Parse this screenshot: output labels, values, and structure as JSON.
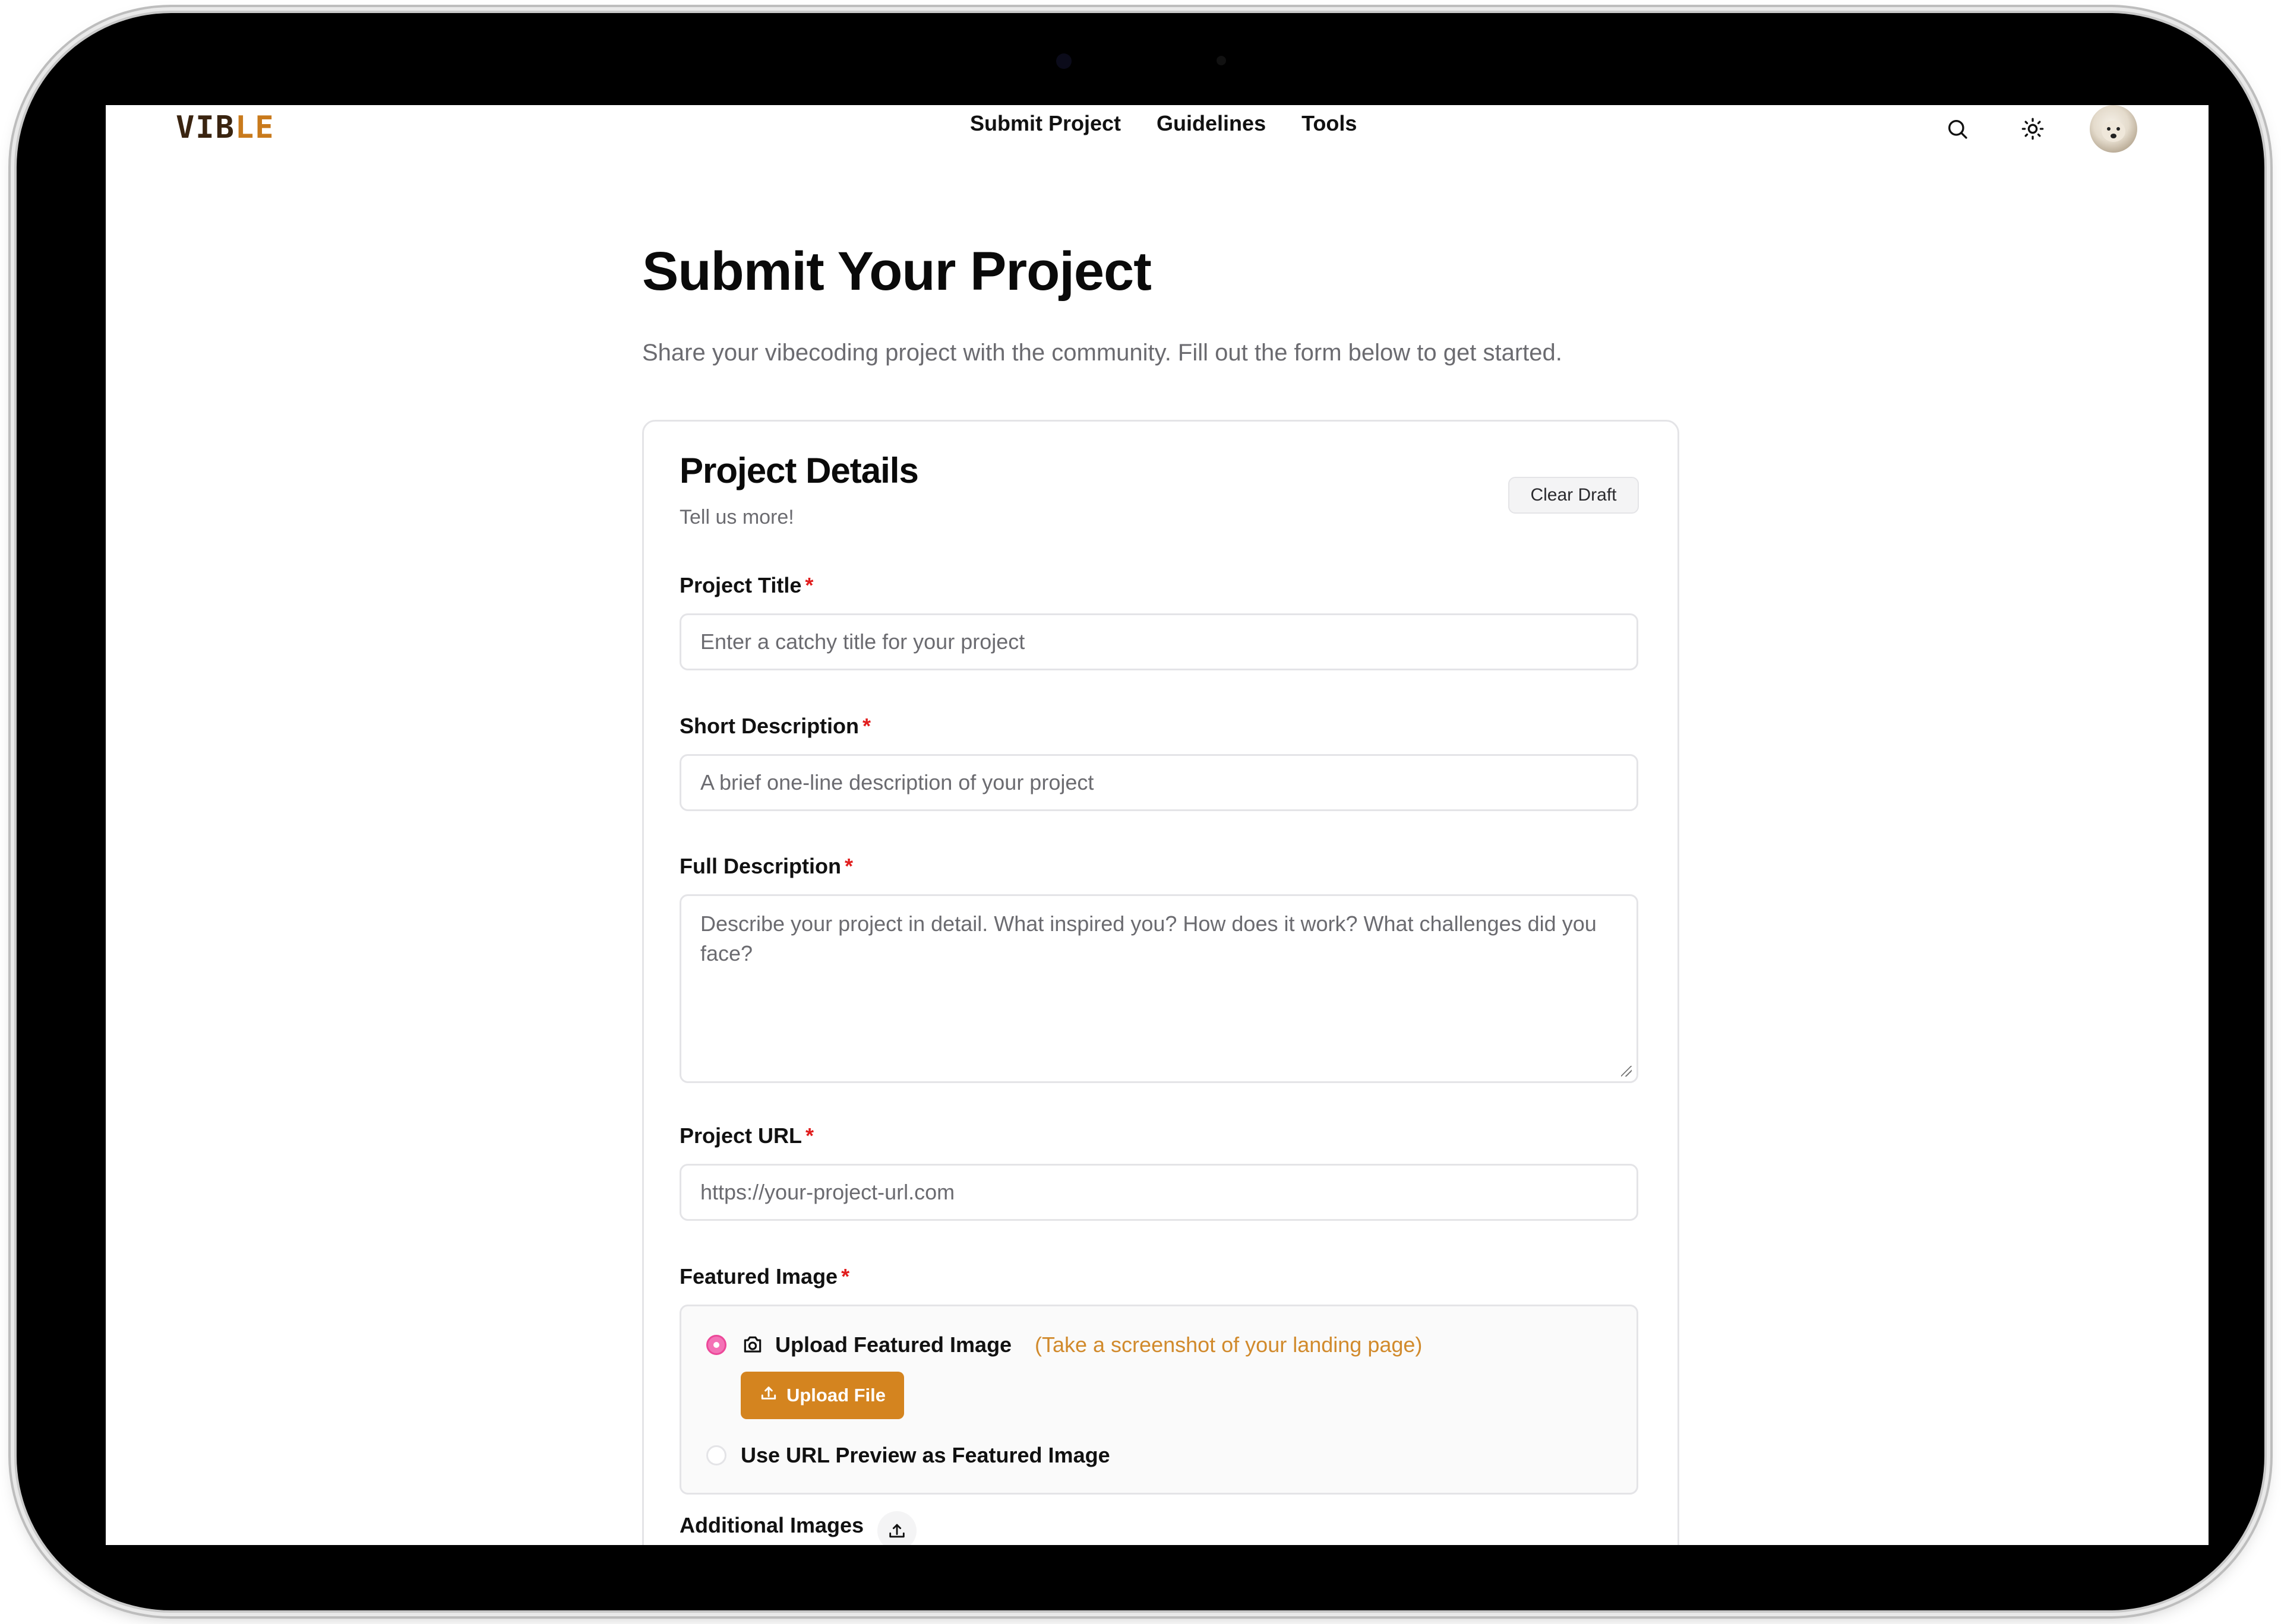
{
  "header": {
    "logo_main": "VIB",
    "logo_accent": "LE",
    "nav": [
      "Submit Project",
      "Guidelines",
      "Tools"
    ],
    "icons": [
      "search-icon",
      "sun-icon",
      "avatar"
    ]
  },
  "page": {
    "title": "Submit Your Project",
    "subtitle": "Share your vibecoding project with the community. Fill out the form below to get started."
  },
  "card": {
    "title": "Project Details",
    "subtitle": "Tell us more!",
    "clear_draft": "Clear Draft"
  },
  "form": {
    "title_label": "Project Title",
    "title_placeholder": "Enter a catchy title for your project",
    "short_label": "Short Description",
    "short_placeholder": "A brief one-line description of your project",
    "full_label": "Full Description",
    "full_placeholder": "Describe your project in detail. What inspired you? How does it work? What challenges did you face?",
    "url_label": "Project URL",
    "url_placeholder": "https://your-project-url.com",
    "featured_label": "Featured Image",
    "option_upload": "Upload Featured Image",
    "option_upload_hint": "(Take a screenshot of your landing page)",
    "upload_button": "Upload File",
    "option_url_preview": "Use URL Preview as Featured Image",
    "selected_option": "Upload Featured Image",
    "additional_label": "Additional Images",
    "required_mark": "*"
  },
  "colors": {
    "accent": "#d4841f",
    "required": "#e11d1d",
    "radio_active": "#ec4899",
    "hint": "#d18a2c"
  }
}
